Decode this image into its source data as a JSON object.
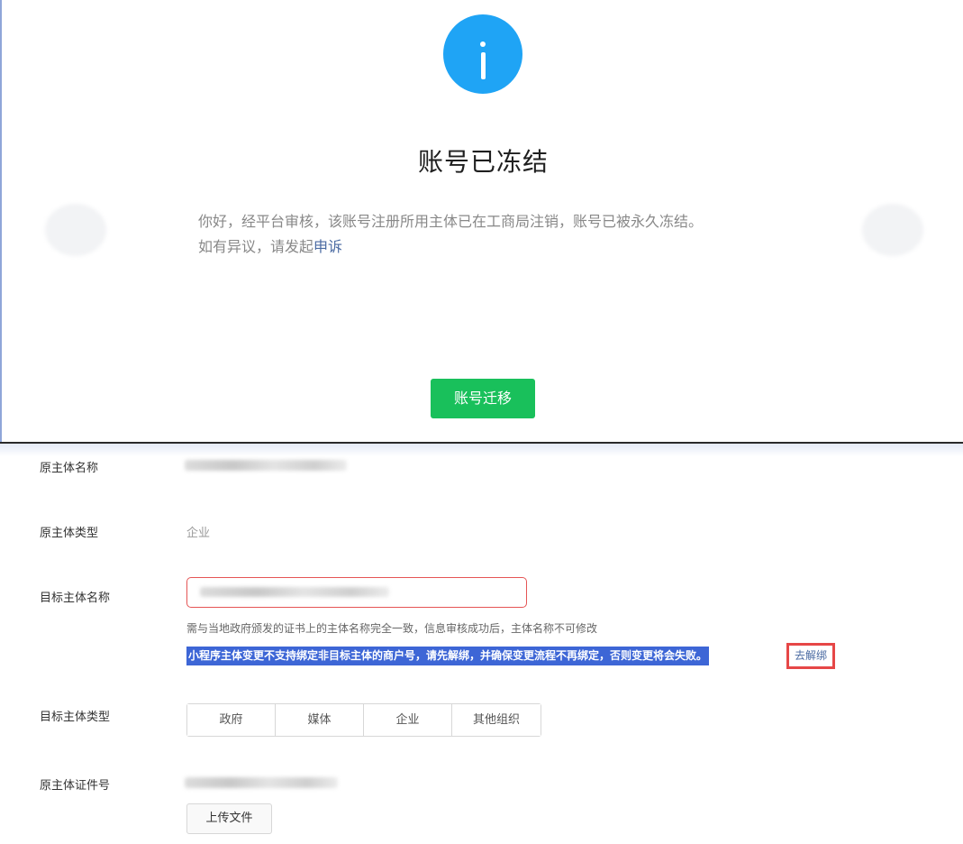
{
  "frozen": {
    "title": "账号已冻结",
    "desc_line1": "你好，经平台审核，该账号注册所用主体已在工商局注销，账号已被永久冻结。",
    "desc_line2_prefix": "如有异议，请发起",
    "appeal_link": "申诉",
    "migrate_button": "账号迁移",
    "icon": "info-icon",
    "accent_color": "#1fa4f5",
    "button_color": "#19c05b"
  },
  "form": {
    "original_name_label": "原主体名称",
    "original_type_label": "原主体类型",
    "original_type_value": "企业",
    "target_name_label": "目标主体名称",
    "target_name_hint": "需与当地政府颁发的证书上的主体名称完全一致，信息审核成功后，主体名称不可修改",
    "warning_text": "小程序主体变更不支持绑定非目标主体的商户号，请先解绑，并确保变更流程不再绑定，否则变更将会失败。",
    "unbind_link": "去解绑",
    "target_type_label": "目标主体类型",
    "target_type_options": [
      "政府",
      "媒体",
      "企业",
      "其他组织"
    ],
    "original_cert_label": "原主体证件号",
    "upload_button": "上传文件"
  }
}
